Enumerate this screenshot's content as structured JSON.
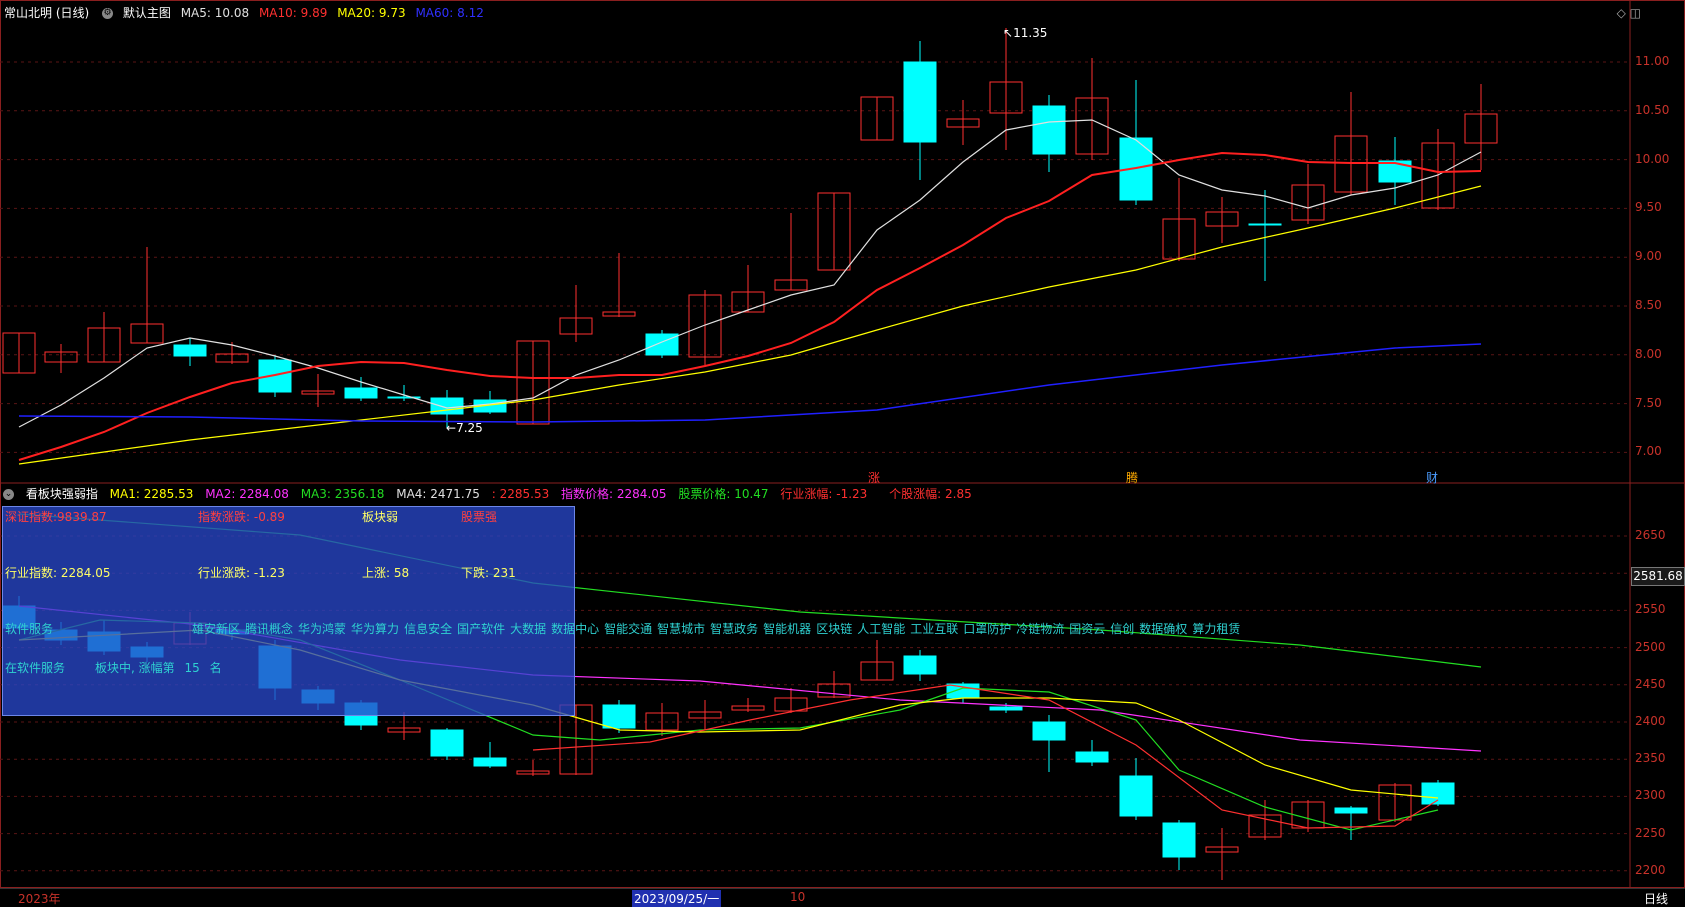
{
  "header": {
    "stock_name": "常山北明 (日线)",
    "template": "默认主图",
    "ma5": "MA5: 10.08",
    "ma10": "MA10: 9.89",
    "ma20": "MA20: 9.73",
    "ma60": "MA60: 8.12"
  },
  "colors": {
    "up": "#ff3030",
    "down": "#00ffff",
    "ma5": "#e0e0e0",
    "ma10": "#ff2020",
    "ma20": "#ffff00",
    "ma60": "#2020ff",
    "axis": "#c8322a",
    "green": "#22dd22",
    "magenta": "#ff33ff"
  },
  "main_chart": {
    "high_label": "11.35",
    "low_label": "7.25",
    "y_ticks": [
      "11.00",
      "10.50",
      "10.00",
      "9.50",
      "9.00",
      "8.50",
      "8.00",
      "7.50",
      "7.00"
    ],
    "markers": [
      "涨",
      "腾",
      "财"
    ]
  },
  "sub_header": {
    "indicator": "看板块强弱指",
    "ma1": "MA1: 2285.53",
    "ma2": "MA2: 2284.08",
    "ma3": "MA3: 2356.18",
    "ma4": "MA4: 2471.75",
    "v5": ": 2285.53",
    "index_price": "指数价格: 2284.05",
    "stock_price": "股票价格: 10.47",
    "industry_change": "行业涨幅: -1.23",
    "stock_change": "个股涨幅: 2.85"
  },
  "info_box": {
    "szzs": "深证指数:9839.87",
    "index_change": "指数涨跌: -0.89",
    "sector_weak": "板块弱",
    "stock_strong": "股票强",
    "industry_index": "行业指数: 2284.05",
    "industry_change": "行业涨跌: -1.23",
    "up_count": "上涨: 58",
    "down_count": "下跌: 231",
    "software_service": "软件服务",
    "in_software": "在软件服务",
    "rank_text": "板块中, 涨幅第",
    "rank_num": "15",
    "rank_unit": "名"
  },
  "concepts": [
    "雄安新区",
    "腾讯概念",
    "华为鸿蒙",
    "华为算力",
    "信息安全",
    "国产软件",
    "大数据",
    "数据中心",
    "智能交通",
    "智慧城市",
    "智慧政务",
    "智能机器",
    "区块链",
    "人工智能",
    "工业互联",
    "口罩防护",
    "冷链物流",
    "国资云",
    "信创",
    "数据确权",
    "算力租赁"
  ],
  "sub_chart": {
    "y_ticks": [
      "2650",
      "2600",
      "2550",
      "2500",
      "2450",
      "2400",
      "2350",
      "2300",
      "2250",
      "2200"
    ],
    "current_tag": "2581.68"
  },
  "bottom": {
    "year": "2023年",
    "date": "2023/09/25/一",
    "month": "10",
    "period": "日线"
  }
}
